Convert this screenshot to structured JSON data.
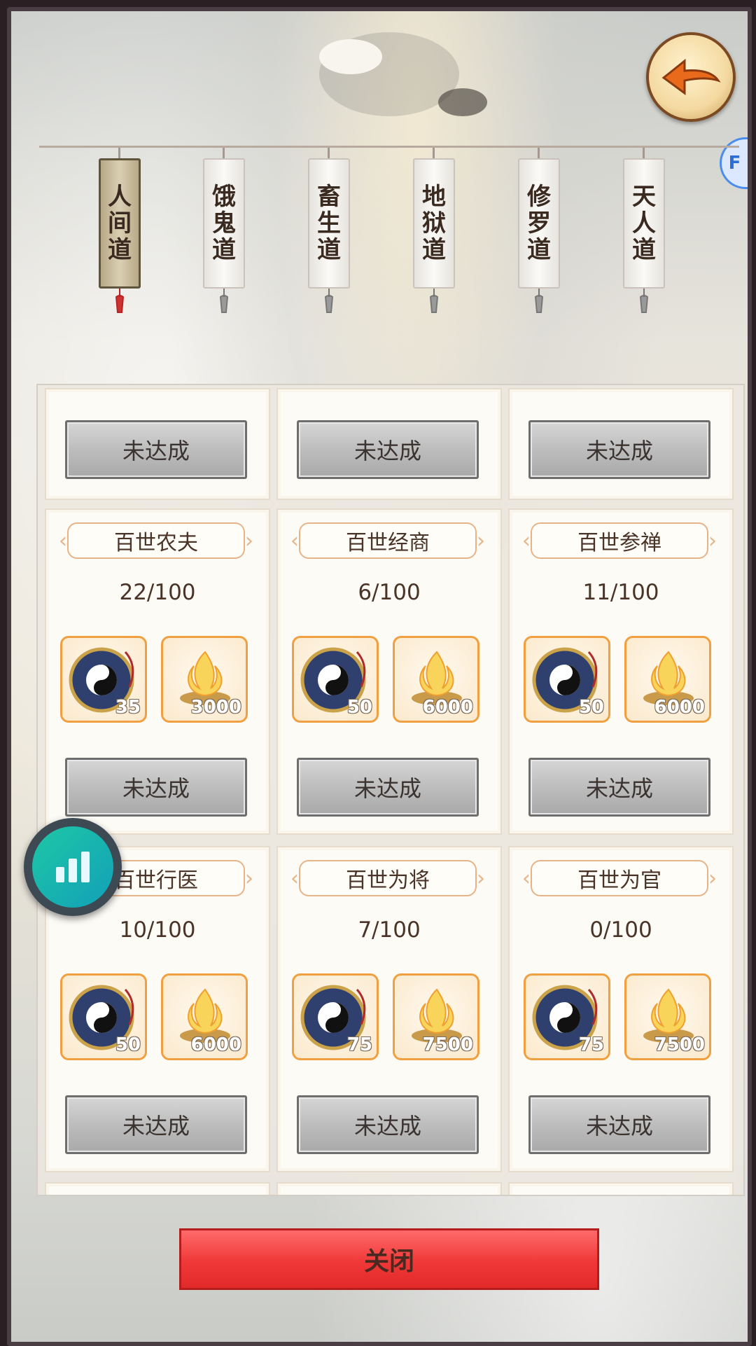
{
  "header": {
    "back_icon": "back-arrow-icon"
  },
  "tabs": [
    {
      "label": "人间道",
      "chars": [
        "人",
        "间",
        "道"
      ],
      "active": true
    },
    {
      "label": "饿鬼道",
      "chars": [
        "饿",
        "鬼",
        "道"
      ],
      "active": false
    },
    {
      "label": "畜生道",
      "chars": [
        "畜",
        "生",
        "道"
      ],
      "active": false
    },
    {
      "label": "地狱道",
      "chars": [
        "地",
        "狱",
        "道"
      ],
      "active": false
    },
    {
      "label": "修罗道",
      "chars": [
        "修",
        "罗",
        "道"
      ],
      "active": false
    },
    {
      "label": "天人道",
      "chars": [
        "天",
        "人",
        "道"
      ],
      "active": false
    }
  ],
  "top_row": [
    {
      "status": "未达成"
    },
    {
      "status": "未达成"
    },
    {
      "status": "未达成"
    }
  ],
  "cards": [
    {
      "title": "百世农夫",
      "progress": "22/100",
      "reward1_qty": "35",
      "reward2_qty": "3000",
      "status": "未达成"
    },
    {
      "title": "百世经商",
      "progress": "6/100",
      "reward1_qty": "50",
      "reward2_qty": "6000",
      "status": "未达成"
    },
    {
      "title": "百世参禅",
      "progress": "11/100",
      "reward1_qty": "50",
      "reward2_qty": "6000",
      "status": "未达成"
    },
    {
      "title": "百世行医",
      "progress": "10/100",
      "reward1_qty": "50",
      "reward2_qty": "6000",
      "status": "未达成"
    },
    {
      "title": "百世为将",
      "progress": "7/100",
      "reward1_qty": "75",
      "reward2_qty": "7500",
      "status": "未达成"
    },
    {
      "title": "百世为官",
      "progress": "0/100",
      "reward1_qty": "75",
      "reward2_qty": "7500",
      "status": "未达成"
    }
  ],
  "reward_icons": {
    "reward1": "taiji-compass-icon",
    "reward2": "golden-flame-icon"
  },
  "footer": {
    "close_label": "关闭"
  },
  "overlay": {
    "float_icon": "bar-chart-icon",
    "edge_tab_label": "F"
  },
  "colors": {
    "close_red": "#f03838",
    "reward_border": "#f0a040",
    "active_tab": "#5f553d"
  }
}
